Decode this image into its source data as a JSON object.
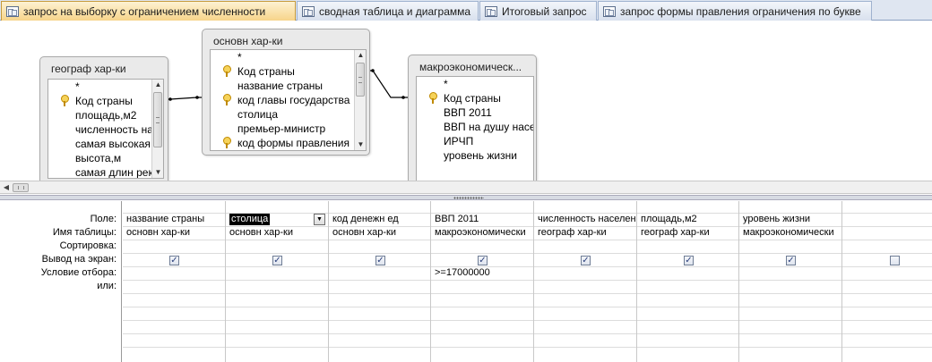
{
  "tabs": [
    {
      "label": "запрос на выборку с ограничением численности",
      "active": true
    },
    {
      "label": "сводная таблица и диаграмма",
      "active": false
    },
    {
      "label": "Итоговый запрос",
      "active": false
    },
    {
      "label": "запрос формы правления ограничения по букве",
      "active": false
    }
  ],
  "tables": [
    {
      "title": "географ хар-ки",
      "fields": [
        {
          "name": "*",
          "key": false
        },
        {
          "name": "Код страны",
          "key": true
        },
        {
          "name": "площадь,м2",
          "key": false
        },
        {
          "name": "численность на",
          "key": false
        },
        {
          "name": "самая высокая",
          "key": false
        },
        {
          "name": "высота,м",
          "key": false
        },
        {
          "name": "самая длин рек",
          "key": false
        }
      ]
    },
    {
      "title": "основн хар-ки",
      "fields": [
        {
          "name": "*",
          "key": false
        },
        {
          "name": "Код страны",
          "key": true
        },
        {
          "name": "название страны",
          "key": false
        },
        {
          "name": "код главы государства",
          "key": true
        },
        {
          "name": "столица",
          "key": false
        },
        {
          "name": "премьер-министр",
          "key": false
        },
        {
          "name": "код формы правления",
          "key": true
        }
      ]
    },
    {
      "title": "макроэкономическ...",
      "fields": [
        {
          "name": "*",
          "key": false
        },
        {
          "name": "Код страны",
          "key": true
        },
        {
          "name": "ВВП 2011",
          "key": false
        },
        {
          "name": "ВВП на душу насел",
          "key": false
        },
        {
          "name": "ИРЧП",
          "key": false
        },
        {
          "name": "уровень жизни",
          "key": false
        }
      ]
    }
  ],
  "grid": {
    "row_labels": [
      "Поле:",
      "Имя таблицы:",
      "Сортировка:",
      "Вывод на экран:",
      "Условие отбора:",
      "или:"
    ],
    "columns": [
      {
        "field": "название страны",
        "table": "основн хар-ки",
        "sort": "",
        "show": true,
        "criteria": "",
        "or": ""
      },
      {
        "field": "столица",
        "table": "основн хар-ки",
        "sort": "",
        "show": true,
        "criteria": "",
        "or": "",
        "selected": true
      },
      {
        "field": "код денежн ед",
        "table": "основн хар-ки",
        "sort": "",
        "show": true,
        "criteria": "",
        "or": ""
      },
      {
        "field": "ВВП 2011",
        "table": "макроэкономически",
        "sort": "",
        "show": true,
        "criteria": ">=17000000",
        "or": ""
      },
      {
        "field": "численность населен",
        "table": "географ хар-ки",
        "sort": "",
        "show": true,
        "criteria": "",
        "or": ""
      },
      {
        "field": "площадь,м2",
        "table": "географ хар-ки",
        "sort": "",
        "show": true,
        "criteria": "",
        "or": ""
      },
      {
        "field": "уровень жизни",
        "table": "макроэкономически",
        "sort": "",
        "show": true,
        "criteria": "",
        "or": ""
      },
      {
        "field": "",
        "table": "",
        "sort": "",
        "show": false,
        "criteria": "",
        "or": ""
      }
    ]
  },
  "icons": {
    "tab": "query-icon",
    "key": "primary-key-icon",
    "dropdown": "chevron-down-icon",
    "check": "checkbox-icon"
  }
}
